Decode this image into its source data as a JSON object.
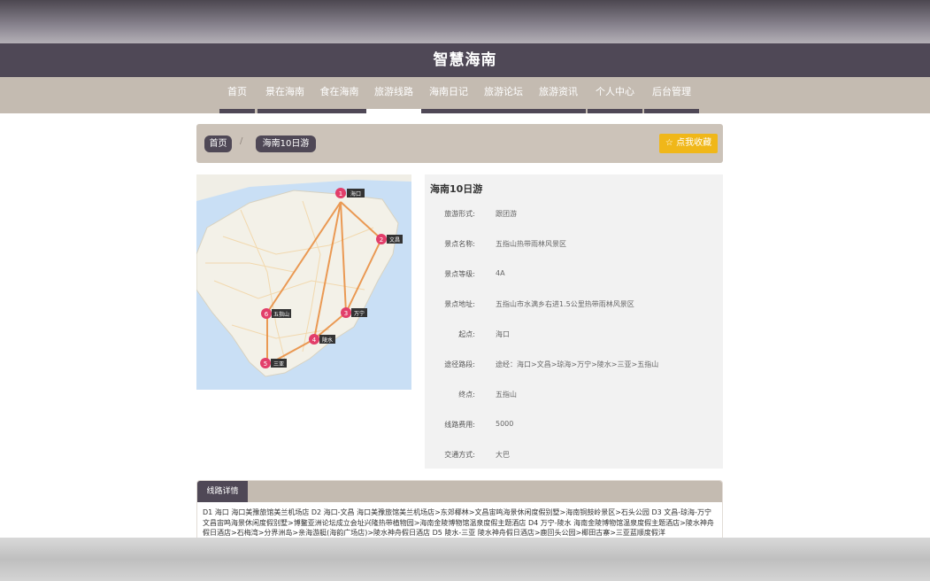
{
  "site_title": "智慧海南",
  "nav": [
    {
      "label": "首页"
    },
    {
      "label": "景在海南"
    },
    {
      "label": "食在海南"
    },
    {
      "label": "旅游线路"
    },
    {
      "label": "海南日记"
    },
    {
      "label": "旅游论坛"
    },
    {
      "label": "旅游资讯"
    },
    {
      "label": "个人中心"
    },
    {
      "label": "后台管理"
    }
  ],
  "nav_active": "旅游线路",
  "breadcrumb": {
    "home": "首页",
    "sep": "/",
    "current": "海南10日游"
  },
  "favorite_label": "☆ 点我收藏",
  "route": {
    "title": "海南10日游",
    "fields": [
      {
        "label": "旅游形式:",
        "value": "跟团游"
      },
      {
        "label": "景点名称:",
        "value": "五指山热带雨林风景区"
      },
      {
        "label": "景点等级:",
        "value": "4A"
      },
      {
        "label": "景点地址:",
        "value": "五指山市水满乡右进1.5公里热带雨林风景区"
      },
      {
        "label": "起点:",
        "value": "海口"
      },
      {
        "label": "途径路段:",
        "value": "途经：海口>文昌>琼海>万宁>陵水>三亚>五指山"
      },
      {
        "label": "终点:",
        "value": "五指山"
      },
      {
        "label": "线路费用:",
        "value": "5000"
      },
      {
        "label": "交通方式:",
        "value": "大巴"
      }
    ]
  },
  "map": {
    "markers": [
      {
        "num": "1",
        "name": "海口"
      },
      {
        "num": "2",
        "name": "文昌"
      },
      {
        "num": "3",
        "name": "万宁"
      },
      {
        "num": "4",
        "name": "陵水"
      },
      {
        "num": "5",
        "name": "三亚"
      },
      {
        "num": "6",
        "name": "五指山"
      }
    ]
  },
  "detail": {
    "tab": "线路详情",
    "text": "D1 海口 海口美豫旅馆美兰机场店 D2 海口-文昌 海口美豫旅馆美兰机场店>东郊椰林>文昌宙鸣海景休闲度假别墅>海南铜鼓岭景区>石头公园 D3 文昌-琼海-万宁 文昌宙鸣海景休闲度假别墅>博鳌亚洲论坛成立会址兴隆热带植物园>海南金陵博物馆温泉度假主题酒店 D4 万宁-陵水 海南金陵博物馆温泉度假主题酒店>陵水神舟假日酒店>石梅湾>分界洲岛>亲海游艇(海韵广场店)>陵水神舟假日酒店 D5 陵水-三亚 陵水神舟假日酒店>鹿回头公园>椰田古寨>三亚蓝顺度假洋"
  },
  "colors": {
    "brand_dark": "#4f4856",
    "nav_bg": "#c4bbb1",
    "accent": "#f0b719",
    "route_line": "#e98a3a",
    "marker": "#e23e6a"
  }
}
